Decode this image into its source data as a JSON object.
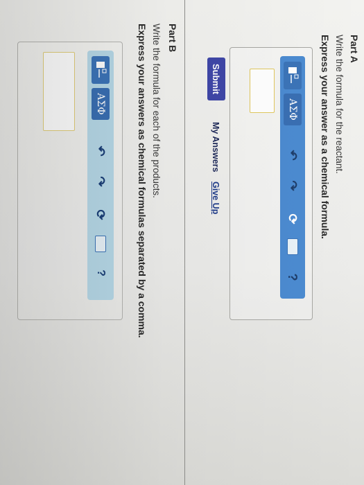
{
  "part_a": {
    "title": "Part A",
    "instruction": "Write the formula for the reactant.",
    "instruction_bold": "Express your answer as a chemical formula.",
    "toolbar": {
      "greek_label": "ΑΣΦ",
      "undo_glyph": "↶",
      "redo_glyph": "↷",
      "reset_glyph": "⟳",
      "help_label": "?"
    },
    "answer_value": "",
    "submit_label": "Submit",
    "my_answers_label": "My Answers",
    "give_up_label": "Give Up"
  },
  "part_b": {
    "title": "Part B",
    "instruction": "Write the formula for each of the products.",
    "instruction_bold": "Express your answers as chemical formulas separated by a comma.",
    "toolbar": {
      "greek_label": "ΑΣΦ",
      "undo_glyph": "↶",
      "redo_glyph": "↷",
      "reset_glyph": "⟳",
      "help_label": "?"
    },
    "answer_value": ""
  },
  "colors": {
    "toolbar_active": "#4c8bd1",
    "toolbar_inactive": "#b7d9e8",
    "submit": "#3f47a8",
    "input_border": "#e1c85d"
  }
}
